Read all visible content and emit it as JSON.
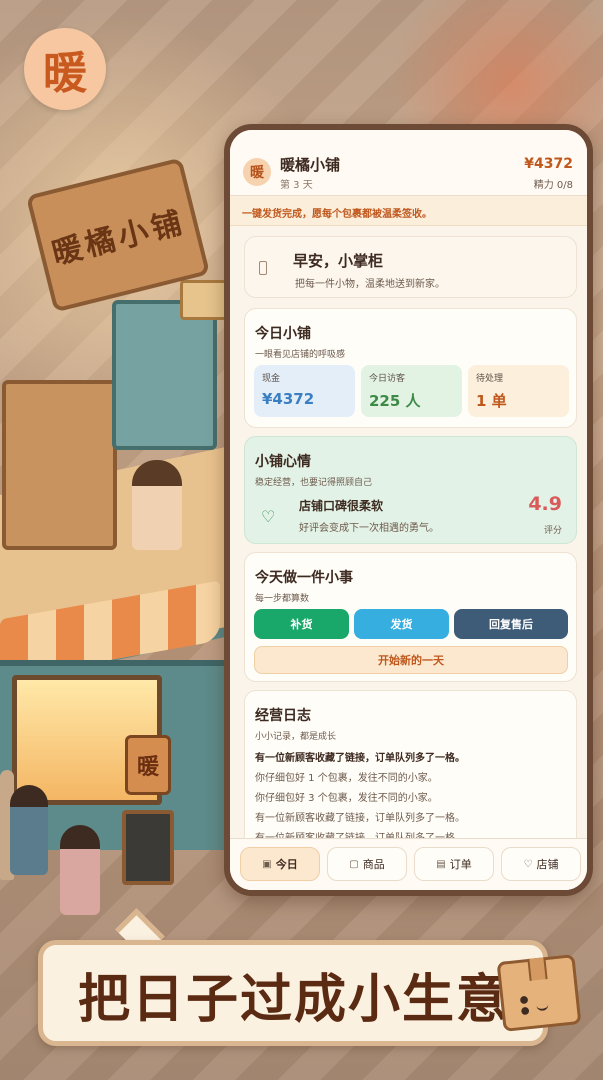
{
  "brand": {
    "logo_char": "暖",
    "sign_text": "暖橘小铺",
    "hanging_sign_char": "暖"
  },
  "app": {
    "avatar_char": "暖",
    "title": "暖橘小铺",
    "day": "第 3 天",
    "money": "¥4372",
    "energy": "精力 0/8",
    "notice": "一键发货完成，愿每个包裹都被温柔签收。"
  },
  "greeting": {
    "title": "早安，小掌柜",
    "text": "把每一件小物，温柔地送到新家。"
  },
  "today": {
    "title": "今日小铺",
    "subtitle": "一眼看见店铺的呼吸感",
    "stats": [
      {
        "label": "现金",
        "value": "¥4372"
      },
      {
        "label": "今日访客",
        "value": "225 人"
      },
      {
        "label": "待处理",
        "value": "1 单"
      }
    ]
  },
  "mood": {
    "title": "小铺心情",
    "subtitle": "稳定经营，也要记得照顾自己",
    "line_title": "店铺口碑很柔软",
    "line_text": "好评会变成下一次相遇的勇气。",
    "score": "4.9",
    "score_label": "评分"
  },
  "task": {
    "title": "今天做一件小事",
    "subtitle": "每一步都算数",
    "buttons": {
      "restock": "补货",
      "ship": "发货",
      "reply": "回复售后"
    },
    "new_day": "开始新的一天"
  },
  "log": {
    "title": "经营日志",
    "subtitle": "小小记录，都是成长",
    "lines": [
      "有一位新顾客收藏了链接，订单队列多了一格。",
      "你仔细包好 1 个包裹，发往不同的小家。",
      "你仔细包好 3 个包裹，发往不同的小家。",
      "有一位新顾客收藏了链接，订单队列多了一格。",
      "有一位新顾客收藏了链接，订单队列多了一格。"
    ]
  },
  "tabs": {
    "today": "今日",
    "goods": "商品",
    "orders": "订单",
    "shop": "店铺"
  },
  "slogan": "把日子过成小生意",
  "colors": {
    "accent": "#c0581d",
    "restock": "#1aa86a",
    "ship": "#37aee0",
    "reply": "#3e5b77",
    "score": "#d85a5a"
  }
}
